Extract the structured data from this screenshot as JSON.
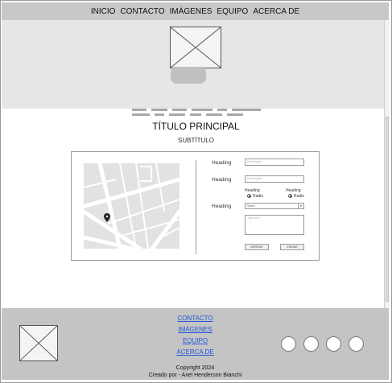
{
  "nav": {
    "items": [
      "INICIO",
      "CONTACTO",
      "IMÁGENES",
      "EQUIPO",
      "ACERCA DE"
    ]
  },
  "hero": {
    "image_icon": "image-placeholder-icon"
  },
  "main": {
    "title": "TÍTULO PRINCIPAL",
    "subtitle": "SUBTÍTULO"
  },
  "form": {
    "heading1": "Heading",
    "placeholder1": "Placeholder",
    "heading2": "Heading",
    "placeholder2": "Placeholder",
    "radio_group": [
      {
        "heading": "Heading",
        "label": "Radio"
      },
      {
        "heading": "Heading",
        "label": "Radio"
      }
    ],
    "heading3": "Heading",
    "select_value": "Select",
    "textarea_placeholder": "Type here",
    "button_left": "BORRAR",
    "button_right": "ENVIAR"
  },
  "footer": {
    "links": [
      "CONTACTO",
      "IMÁGENES",
      "EQUIPO",
      "ACERCA DE"
    ],
    "copyright": "Copyright 2024",
    "credit": "Creado por - Axel Henderson Bianchi"
  }
}
